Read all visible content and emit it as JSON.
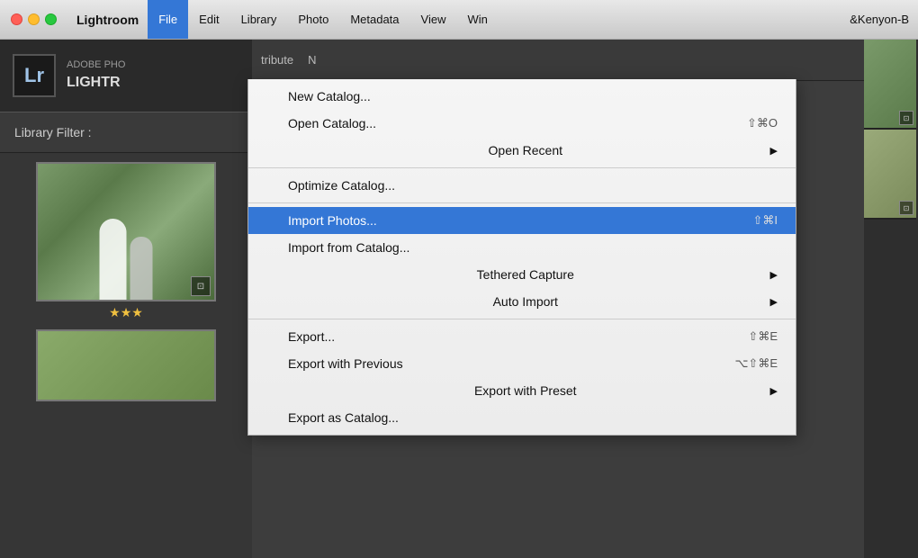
{
  "menubar": {
    "apple_symbol": "🍎",
    "app_name": "Lightroom",
    "items": [
      {
        "label": "File",
        "active": true
      },
      {
        "label": "Edit",
        "active": false
      },
      {
        "label": "Library",
        "active": false
      },
      {
        "label": "Photo",
        "active": false
      },
      {
        "label": "Metadata",
        "active": false
      },
      {
        "label": "View",
        "active": false
      },
      {
        "label": "Win",
        "active": false
      }
    ],
    "window_info": "&Kenyon-B"
  },
  "lr_logo": {
    "icon_text": "Lr",
    "adobe_text": "ADOBE PHO",
    "lightroom_text": "LIGHTR"
  },
  "filter_bar": {
    "label": "Library Filter :"
  },
  "dropdown": {
    "items": [
      {
        "id": "new-catalog",
        "label": "New Catalog...",
        "shortcut": "",
        "has_arrow": false,
        "separator_after": false
      },
      {
        "id": "open-catalog",
        "label": "Open Catalog...",
        "shortcut": "⇧⌘O",
        "has_arrow": false,
        "separator_after": false
      },
      {
        "id": "open-recent",
        "label": "Open Recent",
        "shortcut": "",
        "has_arrow": true,
        "separator_after": true
      },
      {
        "id": "optimize-catalog",
        "label": "Optimize Catalog...",
        "shortcut": "",
        "has_arrow": false,
        "separator_after": true
      },
      {
        "id": "import-photos",
        "label": "Import Photos...",
        "shortcut": "⇧⌘I",
        "has_arrow": false,
        "highlighted": true,
        "separator_after": false
      },
      {
        "id": "import-from-catalog",
        "label": "Import from Catalog...",
        "shortcut": "",
        "has_arrow": false,
        "separator_after": false
      },
      {
        "id": "tethered-capture",
        "label": "Tethered Capture",
        "shortcut": "",
        "has_arrow": true,
        "separator_after": false
      },
      {
        "id": "auto-import",
        "label": "Auto Import",
        "shortcut": "",
        "has_arrow": true,
        "separator_after": true
      },
      {
        "id": "export",
        "label": "Export...",
        "shortcut": "⇧⌘E",
        "has_arrow": false,
        "separator_after": false
      },
      {
        "id": "export-with-previous",
        "label": "Export with Previous",
        "shortcut": "⌥⇧⌘E",
        "has_arrow": false,
        "separator_after": false
      },
      {
        "id": "export-with-preset",
        "label": "Export with Preset",
        "shortcut": "",
        "has_arrow": true,
        "separator_after": false
      },
      {
        "id": "export-as-catalog",
        "label": "Export as Catalog...",
        "shortcut": "",
        "has_arrow": false,
        "separator_after": false
      }
    ]
  },
  "thumbnails": {
    "first_stars": "★★★",
    "badge_icon": "⊡",
    "attribute_label": "tribute",
    "n_label": "N"
  }
}
